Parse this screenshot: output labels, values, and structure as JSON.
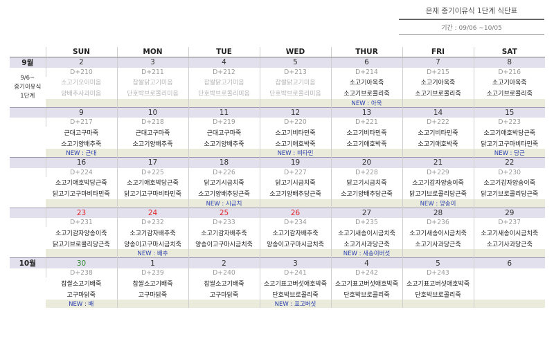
{
  "title": "은재 중기이유식 1단계 식단표",
  "period": "기간 : 09/06 ~10/05",
  "weekdays": [
    "SUN",
    "MON",
    "TUE",
    "WED",
    "THUR",
    "FRI",
    "SAT"
  ],
  "side_label": [
    "9/6~",
    "중기이유식",
    "1단계"
  ],
  "weeks": [
    {
      "month": "9월",
      "days": [
        {
          "date": "2",
          "dday": "D+210",
          "m1": "소고기오이미음",
          "m2": "양배추사과미음",
          "note": "",
          "faded": true
        },
        {
          "date": "3",
          "dday": "D+211",
          "m1": "찹쌀닭고기미음",
          "m2": "단호박브로콜리미음",
          "note": "",
          "faded": true
        },
        {
          "date": "4",
          "dday": "D+212",
          "m1": "찹쌀닭고기미음",
          "m2": "단호박브로콜리미음",
          "note": "",
          "faded": true
        },
        {
          "date": "5",
          "dday": "D+213",
          "m1": "찹쌀닭고기미음",
          "m2": "단호박브로콜리미음",
          "note": "",
          "faded": true
        },
        {
          "date": "6",
          "dday": "D+214",
          "m1": "소고기아욱죽",
          "m2": "소고기브로콜리죽",
          "note": "NEW : 아욱"
        },
        {
          "date": "7",
          "dday": "D+215",
          "m1": "소고기아욱죽",
          "m2": "소고기브로콜리죽",
          "note": ""
        },
        {
          "date": "8",
          "dday": "D+216",
          "m1": "소고기아욱죽",
          "m2": "소고기브로콜리죽",
          "note": ""
        }
      ]
    },
    {
      "month": "",
      "days": [
        {
          "date": "9",
          "dday": "D+217",
          "m1": "근대고구마죽",
          "m2": "소고기양배추죽",
          "note": "NEW : 근대"
        },
        {
          "date": "10",
          "dday": "D+218",
          "m1": "근대고구마죽",
          "m2": "소고기양배추죽",
          "note": ""
        },
        {
          "date": "11",
          "dday": "D+219",
          "m1": "근대고구마죽",
          "m2": "소고기양배추죽",
          "note": ""
        },
        {
          "date": "12",
          "dday": "D+220",
          "m1": "소고기비타민죽",
          "m2": "소고기애호박죽",
          "note": "NEW : 비타민"
        },
        {
          "date": "13",
          "dday": "D+221",
          "m1": "소고기비타민죽",
          "m2": "소고기애호박죽",
          "note": ""
        },
        {
          "date": "14",
          "dday": "D+222",
          "m1": "소고기비타민죽",
          "m2": "소고기애호박죽",
          "note": ""
        },
        {
          "date": "15",
          "dday": "D+223",
          "m1": "소고기애호박당근죽",
          "m2": "닭고기고구마비타민죽",
          "note": "NEW : 당근"
        }
      ]
    },
    {
      "month": "",
      "days": [
        {
          "date": "16",
          "dday": "D+224",
          "m1": "소고기애호박당근죽",
          "m2": "닭고기고구마비타민죽",
          "note": ""
        },
        {
          "date": "17",
          "dday": "D+225",
          "m1": "소고기애호박당근죽",
          "m2": "닭고기고구마비타민죽",
          "note": ""
        },
        {
          "date": "18",
          "dday": "D+226",
          "m1": "닭고기시금치죽",
          "m2": "소고기양배추당근죽",
          "note": "NEW : 시금치"
        },
        {
          "date": "19",
          "dday": "D+227",
          "m1": "닭고기시금치죽",
          "m2": "소고기양배추당근죽",
          "note": ""
        },
        {
          "date": "20",
          "dday": "D+228",
          "m1": "닭고기시금치죽",
          "m2": "소고기양배추당근죽",
          "note": ""
        },
        {
          "date": "21",
          "dday": "D+229",
          "m1": "소고기감자양송이죽",
          "m2": "닭고기브로콜리당근죽",
          "note": "NEW : 양송이"
        },
        {
          "date": "22",
          "dday": "D+230",
          "m1": "소고기감자양송이죽",
          "m2": "닭고기브로콜리당근죽",
          "note": ""
        }
      ]
    },
    {
      "month": "",
      "days": [
        {
          "date": "23",
          "dday": "D+231",
          "m1": "소고기감자양송이죽",
          "m2": "닭고기브로콜리당근죽",
          "note": "",
          "red": true
        },
        {
          "date": "24",
          "dday": "D+232",
          "m1": "소고기감자배추죽",
          "m2": "양송이고구마시금치죽",
          "note": "NEW : 배추",
          "red": true
        },
        {
          "date": "25",
          "dday": "D+233",
          "m1": "소고기감자배추죽",
          "m2": "양송이고구마시금치죽",
          "note": "",
          "red": true
        },
        {
          "date": "26",
          "dday": "D+234",
          "m1": "소고기감자배추죽",
          "m2": "양송이고구마시금치죽",
          "note": "",
          "red": true
        },
        {
          "date": "27",
          "dday": "D+235",
          "m1": "소고기새송이시금치죽",
          "m2": "소고기사과당근죽",
          "note": "NEW : 새송이버섯"
        },
        {
          "date": "28",
          "dday": "D+236",
          "m1": "소고기새송이시금치죽",
          "m2": "소고기사과당근죽",
          "note": ""
        },
        {
          "date": "29",
          "dday": "D+237",
          "m1": "소고기새송이시금치죽",
          "m2": "소고기사과당근죽",
          "note": ""
        }
      ]
    },
    {
      "month": "10월",
      "days": [
        {
          "date": "30",
          "dday": "D+238",
          "m1": "찹쌀소고기배죽",
          "m2": "고구마닭죽",
          "note": "NEW : 배",
          "green": true
        },
        {
          "date": "1",
          "dday": "D+239",
          "m1": "찹쌀소고기배죽",
          "m2": "고구마닭죽",
          "note": ""
        },
        {
          "date": "2",
          "dday": "D+240",
          "m1": "찹쌀소고기배죽",
          "m2": "고구마닭죽",
          "note": ""
        },
        {
          "date": "3",
          "dday": "D+241",
          "m1": "소고기표고버섯애호박죽",
          "m2": "단호박브로콜리죽",
          "note": "NEW : 표고버섯"
        },
        {
          "date": "4",
          "dday": "D+242",
          "m1": "소고기표고버섯애호박죽",
          "m2": "단호박브로콜리죽",
          "note": ""
        },
        {
          "date": "5",
          "dday": "D+243",
          "m1": "소고기표고버섯애호박죽",
          "m2": "단호박브로콜리죽",
          "note": ""
        },
        {
          "date": "6",
          "dday": "",
          "m1": "",
          "m2": "",
          "note": ""
        }
      ]
    }
  ]
}
